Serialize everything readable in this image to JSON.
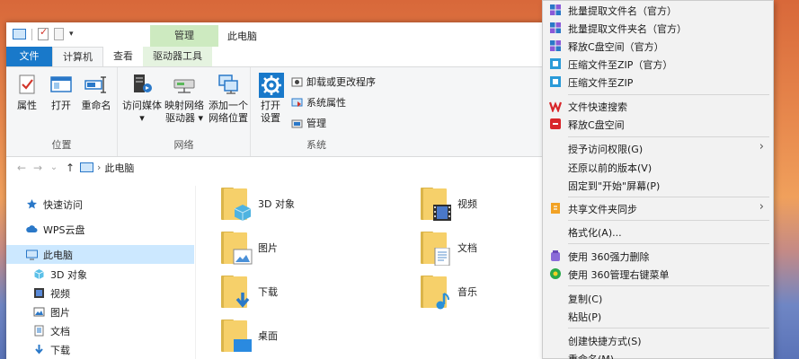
{
  "window": {
    "title": "此电脑",
    "context_tab_group": "管理"
  },
  "tabs": [
    {
      "label": "文件"
    },
    {
      "label": "计算机"
    },
    {
      "label": "查看"
    },
    {
      "label": "驱动器工具"
    }
  ],
  "ribbon": {
    "location": {
      "label": "位置",
      "buttons": [
        {
          "label": "属性",
          "icon": "properties-icon"
        },
        {
          "label": "打开",
          "icon": "open-icon"
        },
        {
          "label": "重命名",
          "icon": "rename-icon"
        }
      ]
    },
    "network": {
      "label": "网络",
      "buttons": [
        {
          "label_line1": "访问媒体",
          "label_line2": "▾",
          "icon": "media-server-icon"
        },
        {
          "label_line1": "映射网络",
          "label_line2": "驱动器 ▾",
          "icon": "map-drive-icon"
        },
        {
          "label_line1": "添加一个",
          "label_line2": "网络位置",
          "icon": "network-location-icon"
        }
      ]
    },
    "system": {
      "label": "系统",
      "open_settings_line1": "打开",
      "open_settings_line2": "设置",
      "small": [
        {
          "label": "卸载或更改程序",
          "icon": "uninstall-icon"
        },
        {
          "label": "系统属性",
          "icon": "system-properties-icon"
        },
        {
          "label": "管理",
          "icon": "manage-icon"
        }
      ]
    }
  },
  "address": {
    "back": "←",
    "forward": "→",
    "recent": "⌄",
    "up": "↑",
    "path": "此电脑"
  },
  "nav_pane": {
    "items": [
      {
        "label": "快速访问",
        "icon": "star-icon"
      },
      {
        "label": "WPS云盘",
        "icon": "cloud-icon"
      },
      {
        "label": "此电脑",
        "icon": "computer-icon",
        "selected": true
      },
      {
        "label": "3D 对象",
        "icon": "cube-icon"
      },
      {
        "label": "视频",
        "icon": "video-icon"
      },
      {
        "label": "图片",
        "icon": "picture-icon"
      },
      {
        "label": "文档",
        "icon": "document-icon"
      },
      {
        "label": "下载",
        "icon": "download-icon"
      }
    ]
  },
  "folders": [
    {
      "label": "3D 对象",
      "icon": "cube-icon"
    },
    {
      "label": "视频",
      "icon": "video-icon"
    },
    {
      "label": "图片",
      "icon": "picture-icon"
    },
    {
      "label": "文档",
      "icon": "document-icon"
    },
    {
      "label": "下载",
      "icon": "download-icon"
    },
    {
      "label": "音乐",
      "icon": "music-icon"
    },
    {
      "label": "桌面",
      "icon": "desktop-icon"
    }
  ],
  "context_menu": {
    "items": [
      {
        "label": "批量提取文件名（官方）",
        "icon": "puzzle-icon"
      },
      {
        "label": "批量提取文件夹名（官方）",
        "icon": "puzzle-icon"
      },
      {
        "label": "释放C盘空间（官方）",
        "icon": "puzzle-icon"
      },
      {
        "label": "压缩文件至ZIP（官方）",
        "icon": "zip-icon"
      },
      {
        "label": "压缩文件至ZIP",
        "icon": "zip-icon"
      },
      {
        "label": "文件快速搜索",
        "icon": "wps-icon"
      },
      {
        "label": "释放C盘空间",
        "icon": "clean-icon"
      },
      {
        "label": "授予访问权限(G)"
      },
      {
        "label": "还原以前的版本(V)"
      },
      {
        "label": "固定到\"开始\"屏幕(P)"
      },
      {
        "label": "共享文件夹同步",
        "icon": "sync-icon"
      },
      {
        "label": "格式化(A)..."
      },
      {
        "label": "使用 360强力删除",
        "icon": "360-delete-icon"
      },
      {
        "label": "使用 360管理右键菜单",
        "icon": "360-manage-icon"
      },
      {
        "label": "复制(C)"
      },
      {
        "label": "粘贴(P)"
      },
      {
        "label": "创建快捷方式(S)"
      },
      {
        "label": "重命名(M)"
      }
    ],
    "submenu_arrow": "›"
  },
  "colors": {
    "file_tab": "#1979ca",
    "selection": "#cce8ff",
    "context_tab": "#cdeac0",
    "folder": "#f6d06a"
  }
}
